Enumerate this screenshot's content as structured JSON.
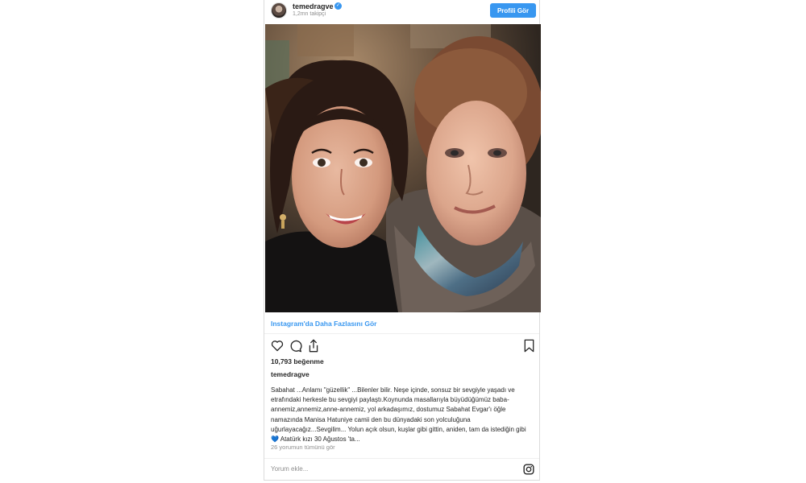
{
  "header": {
    "username": "temedragve",
    "followers": "1,2mn takipçi",
    "profile_button": "Profili Gör",
    "verified_icon": "verified-badge-icon"
  },
  "photo": {
    "description_icon": "photo"
  },
  "more_link": "Instagram'da Daha Fazlasını Gör",
  "actions": {
    "like_icon": "heart-icon",
    "comment_icon": "comment-icon",
    "share_icon": "share-icon",
    "save_icon": "bookmark-icon"
  },
  "likes": "10,793 beğenme",
  "author": "temedragve",
  "caption": {
    "before_heart": "Sabahat ...Anlamı \"güzellik\" ...Bilenler bilir. Neşe içinde, sonsuz bir sevgiyle yaşadı ve etrafındaki herkesle bu sevgiyi paylaştı.Koynunda masallarıyla büyüdüğümüz baba-annemiz,annemiz,anne-annemiz, yol arkadaşımız, dostumuz Sabahat Evgar'ı öğle namazında Manisa Hatuniye camii den bu dünyadaki son yolculuğuna uğurlayacağız...Sevgilim... Yolun açık olsun, kuşlar gibi gittin, aniden, tam da istediğin gibi",
    "heart": "💙",
    "after_heart": " Atatürk kızı 30 Ağustos 'ta..."
  },
  "view_comments": "26 yorumun tümünü gör",
  "comment_placeholder": "Yorum ekle...",
  "colors": {
    "accent": "#3897f0",
    "text": "#262626",
    "muted": "#8e8e8e",
    "border": "#dbdbdb"
  }
}
